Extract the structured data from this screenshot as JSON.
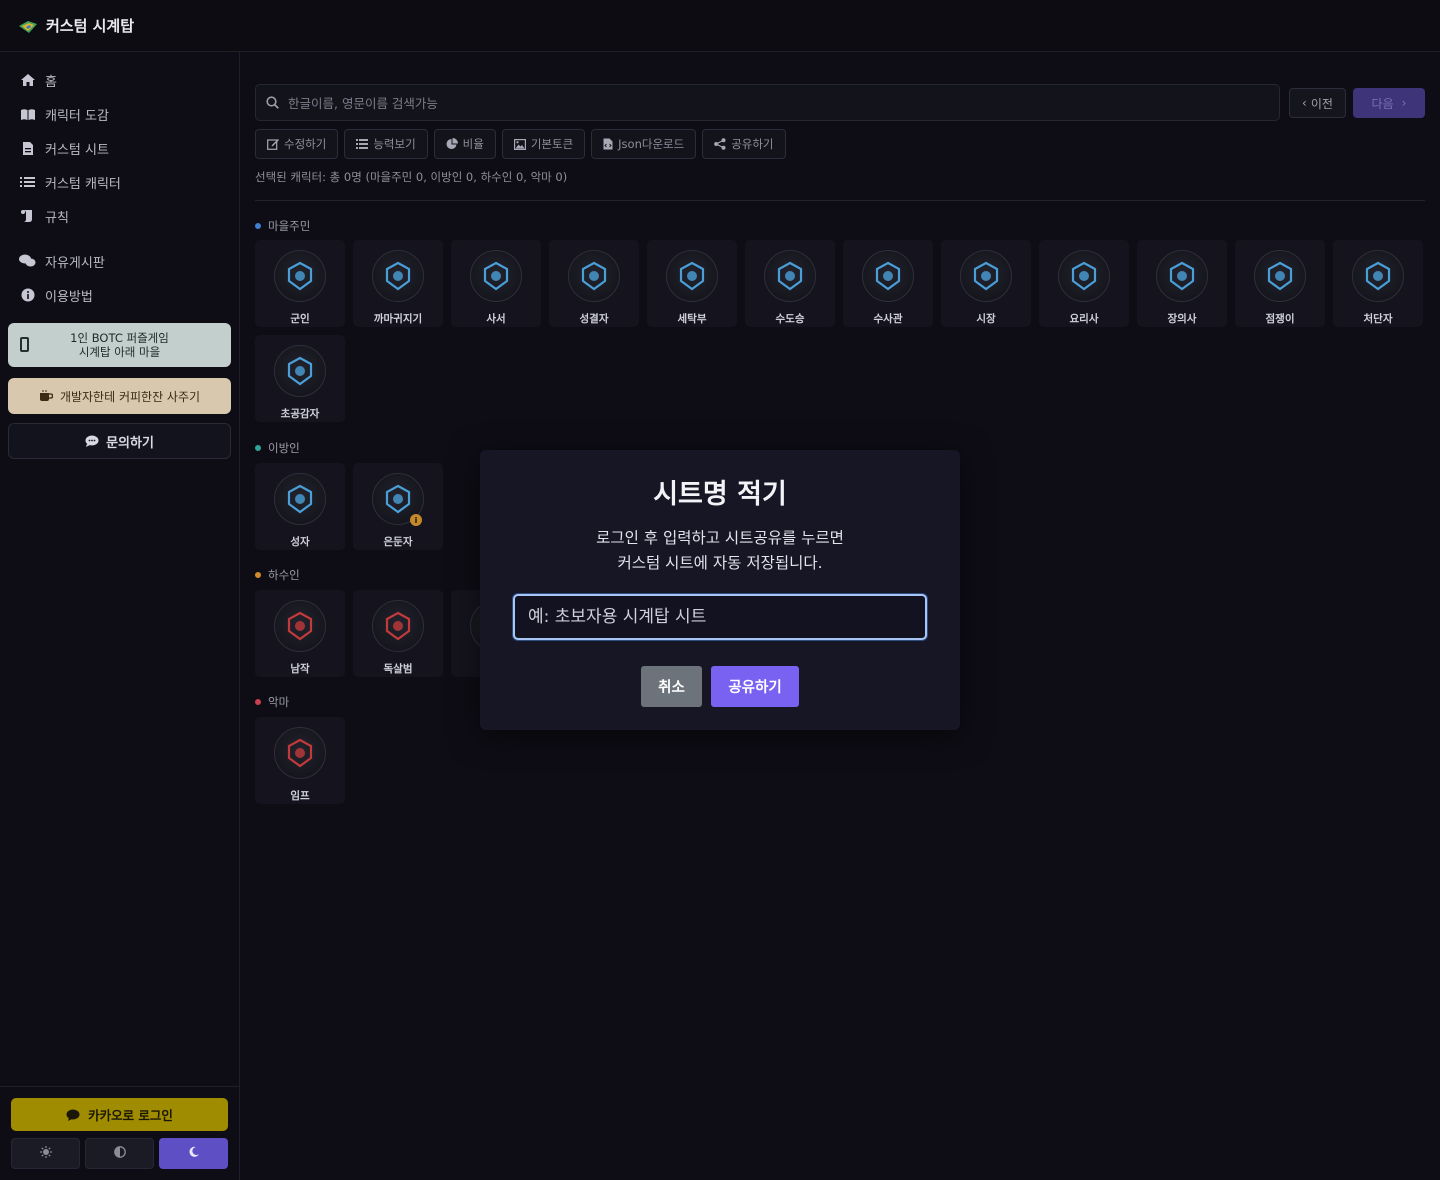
{
  "header": {
    "title": "커스텀 시계탑"
  },
  "sidebar": {
    "nav": [
      "홈",
      "캐릭터 도감",
      "커스텀 시트",
      "커스텀 캐릭터",
      "규칙",
      "자유게시판",
      "이용방법"
    ],
    "promo_app_line1": "1인 BOTC 퍼즐게임",
    "promo_app_line2": "시계탑 아래 마을",
    "promo_coffee": "개발자한테 커피한잔 사주기",
    "promo_ask": "문의하기",
    "kakao_login": "카카오로 로그인"
  },
  "search": {
    "placeholder": "한글이름, 영문이름 검색가능"
  },
  "pager": {
    "prev": "이전",
    "next": "다음"
  },
  "toolbar": [
    "수정하기",
    "능력보기",
    "비율",
    "기본토큰",
    "Json다운로드",
    "공유하기"
  ],
  "selected_text": "선택된 캐릭터: 총 0명 (마을주민 0, 이방인 0, 하수인 0, 악마 0)",
  "groups": {
    "townsfolk": {
      "title": "마을주민",
      "color": "#3f7fd0",
      "items": [
        "군인",
        "까마귀지기",
        "사서",
        "성결자",
        "세탁부",
        "수도승",
        "수사관",
        "시장",
        "요리사",
        "장의사",
        "점쟁이",
        "처단자",
        "초공감자"
      ]
    },
    "outsiders": {
      "title": "이방인",
      "color": "#2fa39a",
      "items": [
        "성자",
        "은둔자"
      ],
      "badge": "i"
    },
    "minions": {
      "title": "하수인",
      "color": "#d08a2a",
      "items": [
        "남작",
        "독살범",
        ""
      ]
    },
    "demons": {
      "title": "악마",
      "color": "#c8404f",
      "items": [
        "임프"
      ]
    }
  },
  "modal": {
    "title": "시트명 적기",
    "desc_line1": "로그인 후 입력하고 시트공유를 누르면",
    "desc_line2": "커스텀 시트에 자동 저장됩니다.",
    "input_placeholder": "예: 초보자용 시계탑 시트",
    "cancel": "취소",
    "share": "공유하기"
  }
}
